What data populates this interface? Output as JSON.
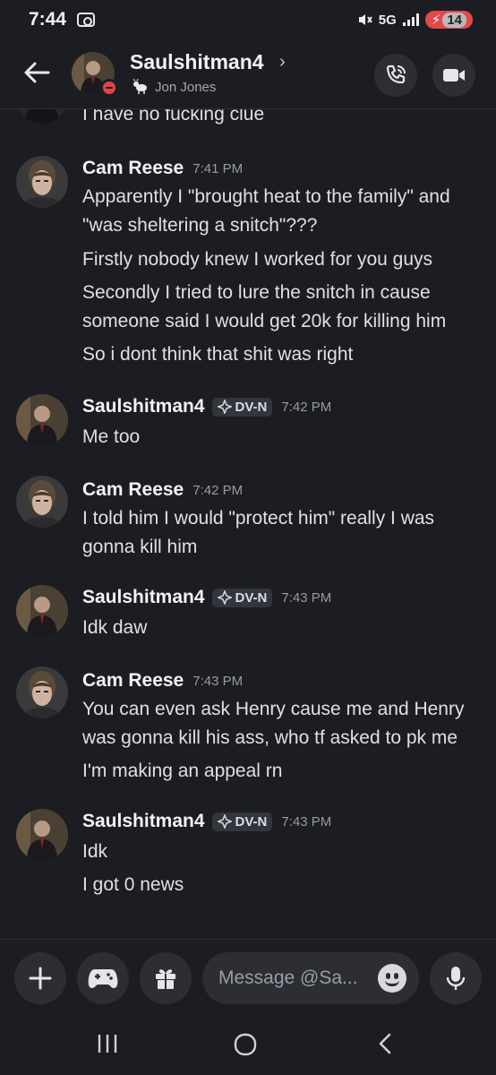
{
  "status_bar": {
    "time": "7:44",
    "network": "5G",
    "battery": "14"
  },
  "header": {
    "name": "Saulshitman4",
    "subtitle": "Jon Jones"
  },
  "messages": [
    {
      "type": "continuation",
      "lines": [
        "I have no fucking clue"
      ]
    },
    {
      "author": "Cam Reese",
      "time": "7:41 PM",
      "tag": "",
      "lines": [
        "Apparently I \"brought heat to the family\" and",
        "\"was sheltering a snitch\"???",
        "Firstly nobody knew I worked for you guys",
        "Secondly I tried to lure the snitch in cause",
        "someone said I would get 20k for killing him",
        "So i dont think that shit was right"
      ]
    },
    {
      "author": "Saulshitman4",
      "time": "7:42 PM",
      "tag": "DV-N",
      "lines": [
        "Me too"
      ]
    },
    {
      "author": "Cam Reese",
      "time": "7:42 PM",
      "tag": "",
      "lines": [
        "I told him I would \"protect him\" really I was",
        "gonna kill him"
      ]
    },
    {
      "author": "Saulshitman4",
      "time": "7:43 PM",
      "tag": "DV-N",
      "lines": [
        "Idk daw"
      ]
    },
    {
      "author": "Cam Reese",
      "time": "7:43 PM",
      "tag": "",
      "lines": [
        "You can even ask Henry cause me and Henry",
        "was gonna kill his ass, who tf asked to pk me",
        "I'm making an appeal rn"
      ]
    },
    {
      "author": "Saulshitman4",
      "time": "7:43 PM",
      "tag": "DV-N",
      "lines": [
        "Idk",
        "I got 0 news"
      ]
    }
  ],
  "composer": {
    "placeholder": "Message @Sa..."
  },
  "colors": {
    "background": "#1c1d22",
    "dnd_status": "#e0474c",
    "button_bg": "#2c2e34"
  },
  "icons": [
    "back-arrow-icon",
    "phone-icon",
    "video-camera-icon",
    "plus-icon",
    "gamepad-icon",
    "gift-icon",
    "emoji-icon",
    "microphone-icon",
    "recent-apps-icon",
    "home-icon",
    "nav-back-icon"
  ]
}
